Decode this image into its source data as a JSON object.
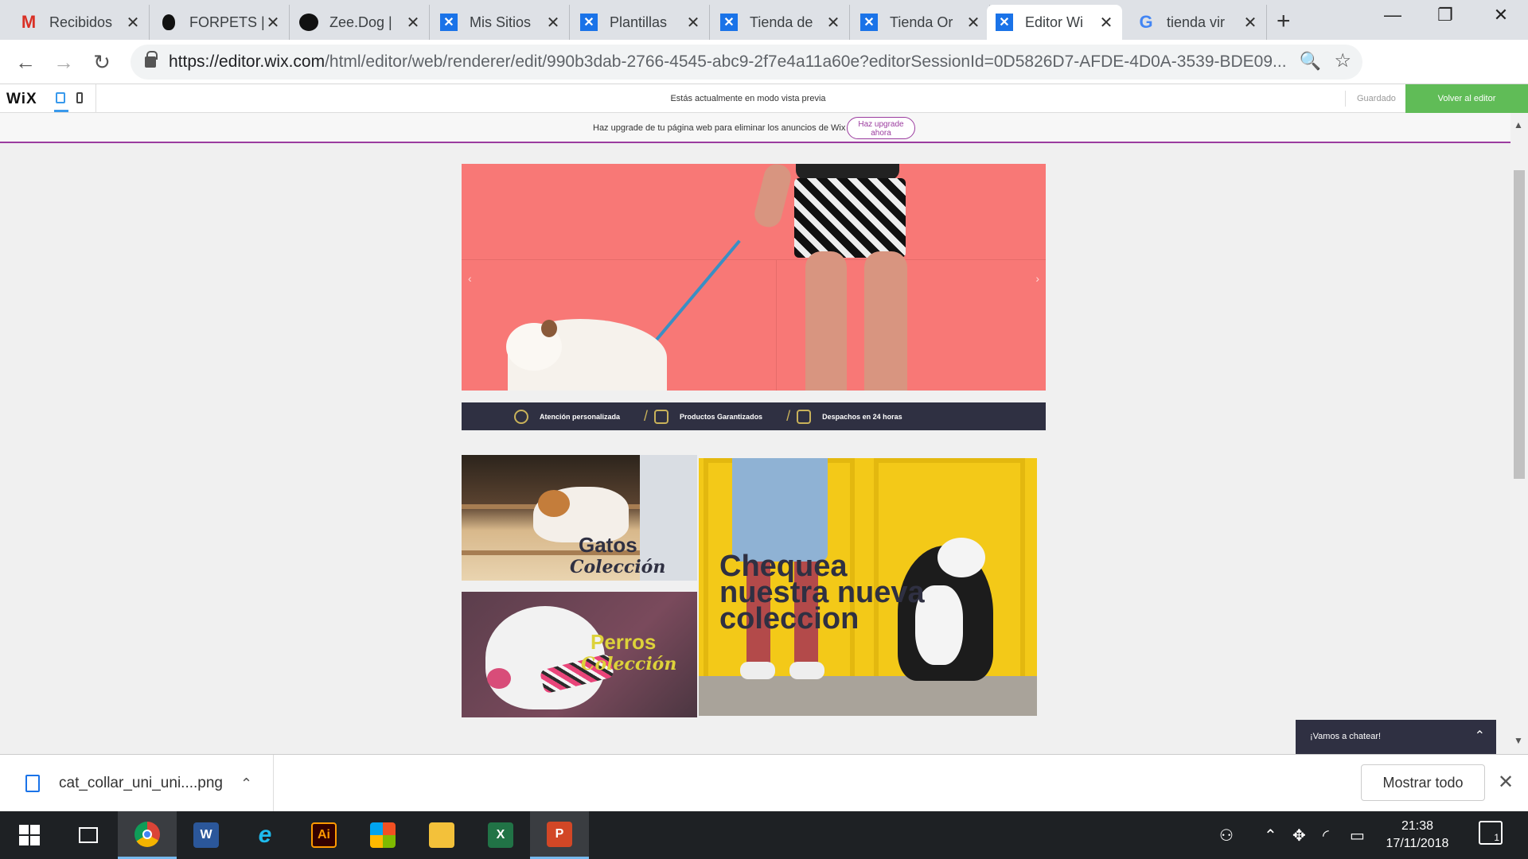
{
  "browser": {
    "tabs": [
      {
        "title": "Recibidos",
        "icon": "gmail-icon"
      },
      {
        "title": "FORPETS |",
        "icon": "forpets-icon"
      },
      {
        "title": "Zee.Dog |",
        "icon": "zeedog-icon"
      },
      {
        "title": "Mis Sitios",
        "icon": "wix-icon"
      },
      {
        "title": "Plantillas",
        "icon": "wix-icon"
      },
      {
        "title": "Tienda de",
        "icon": "wix-icon"
      },
      {
        "title": "Tienda Or",
        "icon": "wix-icon"
      },
      {
        "title": "Editor Wi",
        "icon": "wix-icon",
        "active": true
      },
      {
        "title": "tienda vir",
        "icon": "google-icon"
      }
    ],
    "url_host": "https://editor.wix.com",
    "url_path": "/html/editor/web/renderer/edit/990b3dab-2766-4545-abc9-2f7e4a11a60e?editorSessionId=0D5826D7-AFDE-4D0A-3539-BDE09..."
  },
  "wix_bar": {
    "logo": "WiX",
    "preview_message": "Estás actualmente en modo vista previa",
    "saved_label": "Guardado",
    "back_button": "Volver al editor"
  },
  "upgrade_banner": {
    "message": "Haz upgrade de tu página web para eliminar los anuncios de Wix",
    "button": "Haz upgrade ahora",
    "accent_color": "#9b3c9f"
  },
  "site": {
    "benefits": [
      {
        "label": "Atención personalizada",
        "icon": "headset-icon"
      },
      {
        "label": "Productos Garantizados",
        "icon": "certificate-icon"
      },
      {
        "label": "Despachos en 24 horas",
        "icon": "truck-icon"
      }
    ],
    "cats_tile": {
      "title": "Gatos",
      "subtitle": "Colección"
    },
    "dogs_tile": {
      "title": "Perros",
      "subtitle": "Colección"
    },
    "featured_headline": "Chequea nuestra nueva coleccion",
    "chat_label": "¡Vamos a chatear!",
    "colors": {
      "hero_bg": "#f87876",
      "dark_navy": "#2f3042",
      "gold": "#c9b25a",
      "yellow": "#f3c918"
    }
  },
  "download_shelf": {
    "file_name": "cat_collar_uni_uni....png",
    "show_all": "Mostrar todo"
  },
  "taskbar": {
    "apps": [
      "windows-start",
      "task-view",
      "chrome",
      "word",
      "internet-explorer",
      "illustrator",
      "microsoft-store",
      "file-explorer",
      "excel",
      "powerpoint"
    ],
    "time": "21:38",
    "date": "17/11/2018",
    "notifications": "1"
  }
}
